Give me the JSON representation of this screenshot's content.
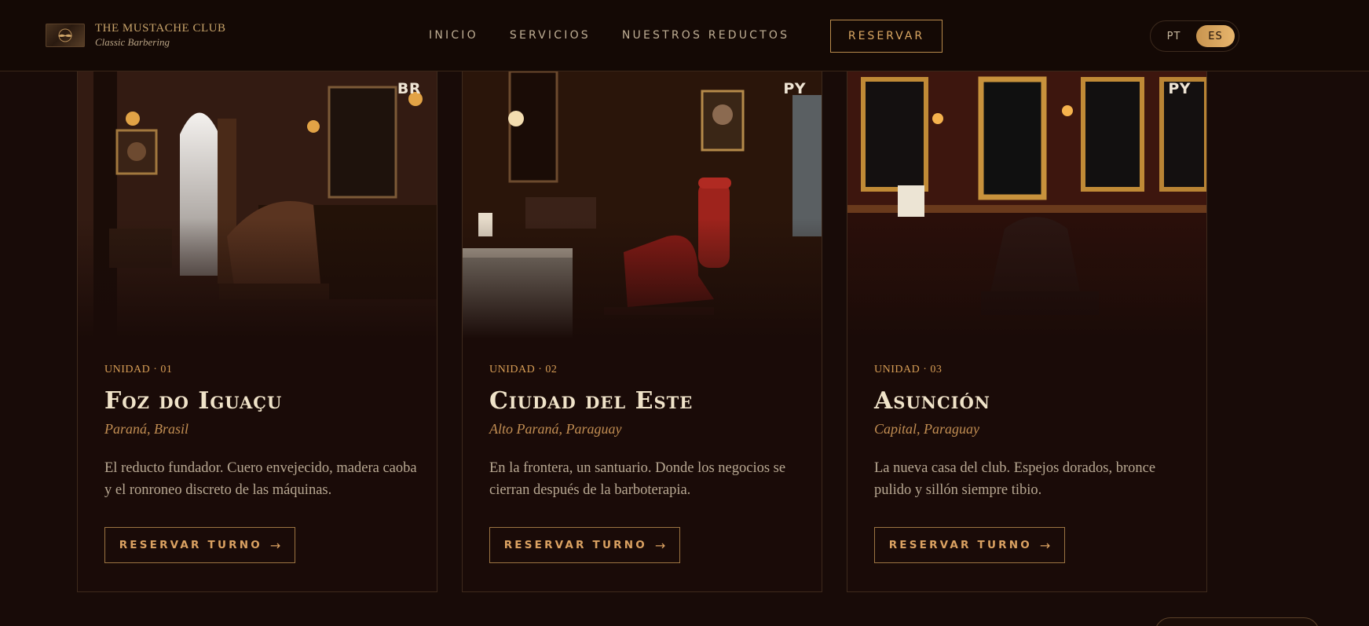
{
  "brand": {
    "name": "THE MUSTACHE CLUB",
    "tagline": "Classic Barbering"
  },
  "nav": {
    "items": [
      {
        "label": "INICIO"
      },
      {
        "label": "SERVICIOS"
      },
      {
        "label": "NUESTROS REDUCTOS"
      }
    ],
    "reserve_label": "RESERVAR"
  },
  "language": {
    "options": [
      "PT",
      "ES"
    ],
    "selected": "ES"
  },
  "cards": [
    {
      "country": "BR",
      "unit": "UNIDAD · 01",
      "city": "Foz do Iguaçu",
      "region": "Paraná, Brasil",
      "description": "El reducto fundador. Cuero envejecido, madera caoba y el ronroneo discreto de las máquinas.",
      "button_label": "RESERVAR TURNO",
      "button_icon": "arrow-right-icon"
    },
    {
      "country": "PY",
      "unit": "UNIDAD · 02",
      "city": "Ciudad del Este",
      "region": "Alto Paraná, Paraguay",
      "description": "En la frontera, un santuario. Donde los negocios se cierran después de la barboterapia.",
      "button_label": "RESERVAR TURNO",
      "button_icon": "arrow-right-icon"
    },
    {
      "country": "PY",
      "unit": "UNIDAD · 03",
      "city": "Asunción",
      "region": "Capital, Paraguay",
      "description": "La nueva casa del club. Espejos dorados, bronce pulido y sillón siempre tibio.",
      "button_label": "RESERVAR TURNO",
      "button_icon": "arrow-right-icon"
    }
  ],
  "colors": {
    "background": "#180b08",
    "accent_gold": "#dba262",
    "text_cream": "#f0e3c9"
  }
}
